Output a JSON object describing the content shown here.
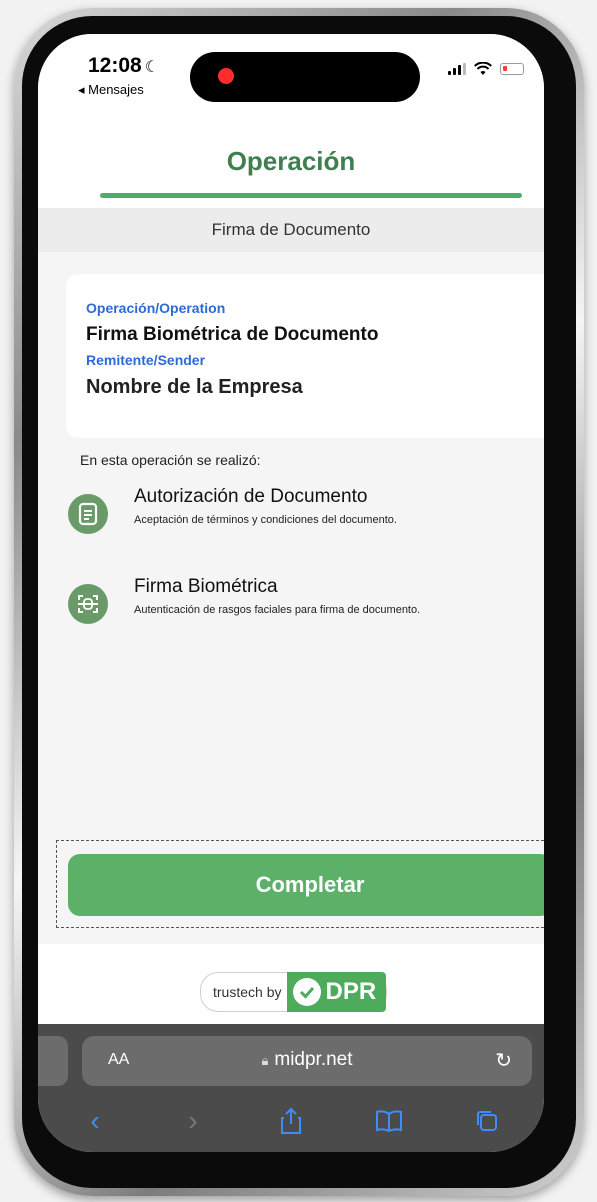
{
  "status_bar": {
    "time": "12:08",
    "back_app": "◂ Mensajes"
  },
  "page": {
    "title": "Operación",
    "section": "Firma de Documento"
  },
  "card": {
    "operation_label": "Operación/Operation",
    "operation_value": "Firma Biométrica de Documento",
    "sender_label": "Remitente/Sender",
    "sender_value": "Nombre de la Empresa"
  },
  "intro": "En esta operación se realizó:",
  "operations": [
    {
      "icon": "document-icon",
      "title": "Autorización de Documento",
      "description": "Aceptación de términos y condiciones del documento."
    },
    {
      "icon": "face-scan-icon",
      "title": "Firma Biométrica",
      "description": "Autenticación de rasgos faciales para firma de documento."
    }
  ],
  "complete_button": "Completar",
  "footer": {
    "badge_text": "trustech by",
    "brand": "DPR"
  },
  "browser": {
    "aa": "AA",
    "url": "midpr.net"
  },
  "colors": {
    "title_green": "#3e7f4f",
    "button_green": "#5cb068",
    "label_blue": "#2b6bd6",
    "icon_green": "#6a9a68",
    "toolbar_blue": "#3f8cff"
  }
}
